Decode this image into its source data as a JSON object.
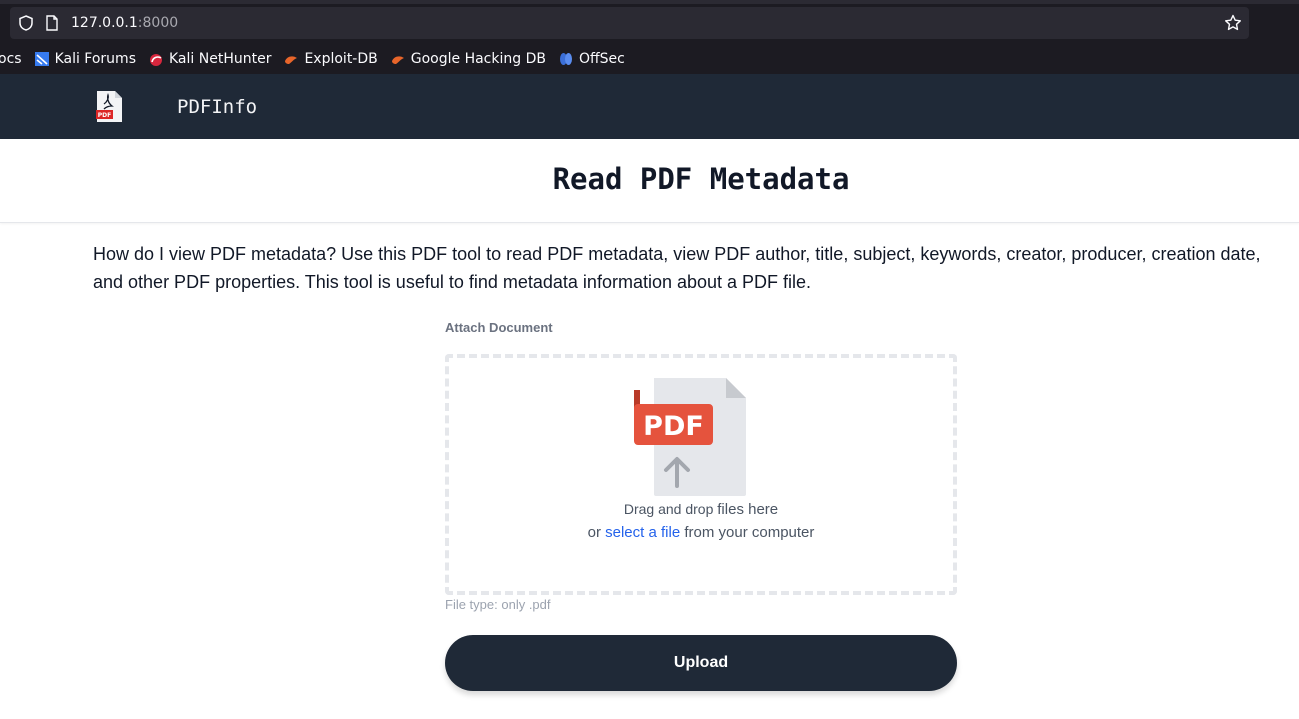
{
  "browser": {
    "url_host": "127.0.0.1",
    "url_port": ":8000",
    "bookmarks": [
      {
        "label": "ocs",
        "icon": "none"
      },
      {
        "label": "Kali Forums",
        "icon": "kali-forums-icon"
      },
      {
        "label": "Kali NetHunter",
        "icon": "kali-nethunter-icon"
      },
      {
        "label": "Exploit-DB",
        "icon": "exploit-db-icon"
      },
      {
        "label": "Google Hacking DB",
        "icon": "ghdb-icon"
      },
      {
        "label": "OffSec",
        "icon": "offsec-icon"
      }
    ]
  },
  "header": {
    "brand": "PDFInfo",
    "logo_icon": "pdf-file-icon"
  },
  "main": {
    "title": "Read PDF Metadata",
    "description": "How do I view PDF metadata? Use this PDF tool to read PDF metadata, view PDF author, title, subject, keywords, creator, producer, creation date, and other PDF properties. This tool is useful to find metadata information about a PDF file.",
    "attach_label": "Attach Document",
    "dropzone": {
      "illustration_text": "PDF",
      "drag_prefix": "Drag and drop ",
      "drag_suffix": "files here",
      "or_prefix": "or ",
      "select_link": "select a file",
      "or_suffix": " from your computer"
    },
    "file_type_hint": "File type: only .pdf",
    "upload_label": "Upload"
  },
  "colors": {
    "header_bg": "#1f2937",
    "pdf_red": "#e5533d",
    "link_blue": "#2563eb"
  }
}
